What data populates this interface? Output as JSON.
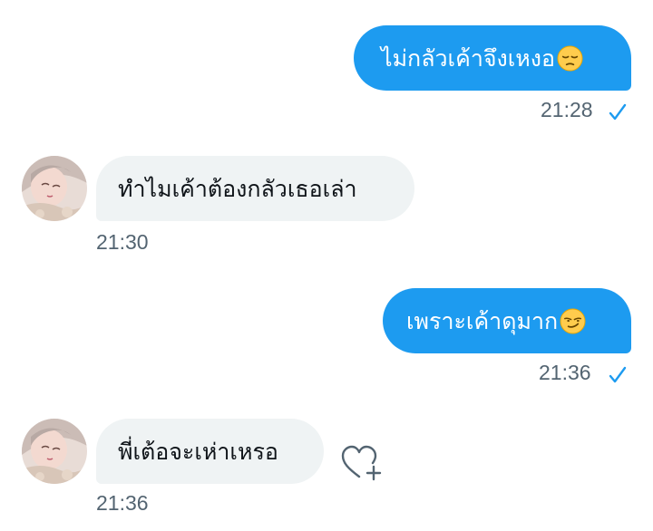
{
  "conversation": {
    "messages": [
      {
        "direction": "sent",
        "text": "ไม่กลัวเค้าจึงเหงอ",
        "emoji": "pensive-face",
        "time": "21:28",
        "status": "sent-check"
      },
      {
        "direction": "received",
        "text": "ทำไมเค้าต้องกลัวเธอเล่า",
        "time": "21:30"
      },
      {
        "direction": "sent",
        "text": "เพราะเค้าดุมาก",
        "emoji": "smirking-face",
        "time": "21:36",
        "status": "sent-check"
      },
      {
        "direction": "received",
        "text": "พี่เต้อจะเห่าเหรอ",
        "time": "21:36",
        "reaction_button": "heart-plus-icon"
      }
    ]
  },
  "colors": {
    "sent_bubble": "#1d9bf0",
    "received_bubble": "#eff3f4",
    "timestamp": "#536471",
    "check": "#1d9bf0"
  }
}
